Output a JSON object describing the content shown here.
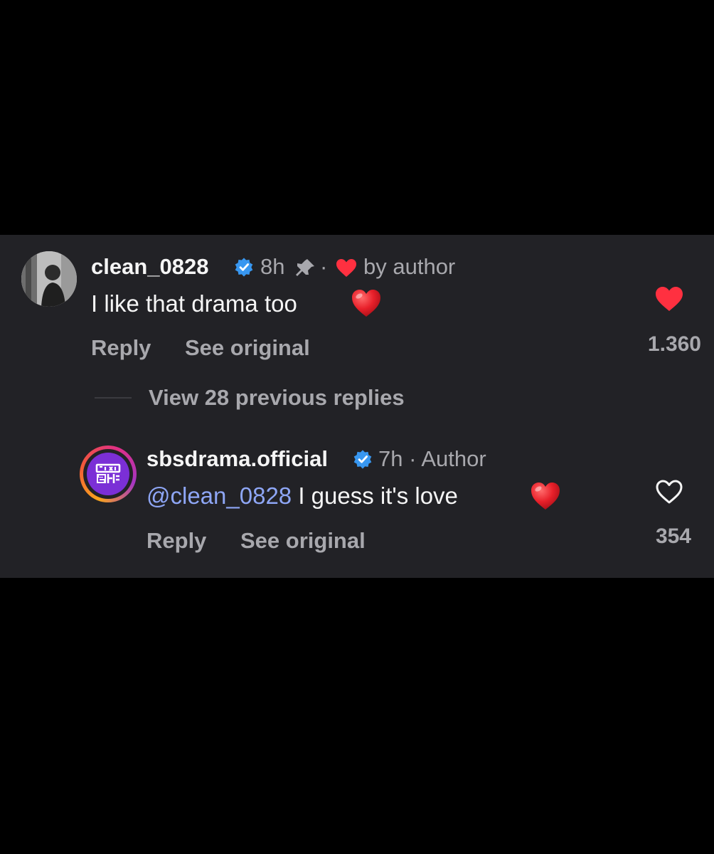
{
  "colors": {
    "background": "#000000",
    "panel": "#222226",
    "text_primary": "#f5f5f5",
    "text_secondary": "#a8a8ad",
    "mention": "#8ea6f5",
    "verified": "#3897f0",
    "heart": "#ff3040"
  },
  "comment": {
    "username": "clean_0828",
    "time": "8h",
    "separator": "·",
    "liked_by": "by author",
    "text": "I like that drama too",
    "reply_label": "Reply",
    "see_original_label": "See original",
    "like_count": "1.360",
    "like_icon": "heart-filled-icon"
  },
  "view_replies": {
    "label": "View 28 previous replies"
  },
  "reply": {
    "username": "sbsdrama.official",
    "time": "7h · Author",
    "mention": "@clean_0828",
    "text": " I guess it's love",
    "reply_label": "Reply",
    "see_original_label": "See original",
    "like_count": "354",
    "like_icon": "heart-outline-icon",
    "avatar_logo_text": "SBS 드라마"
  }
}
